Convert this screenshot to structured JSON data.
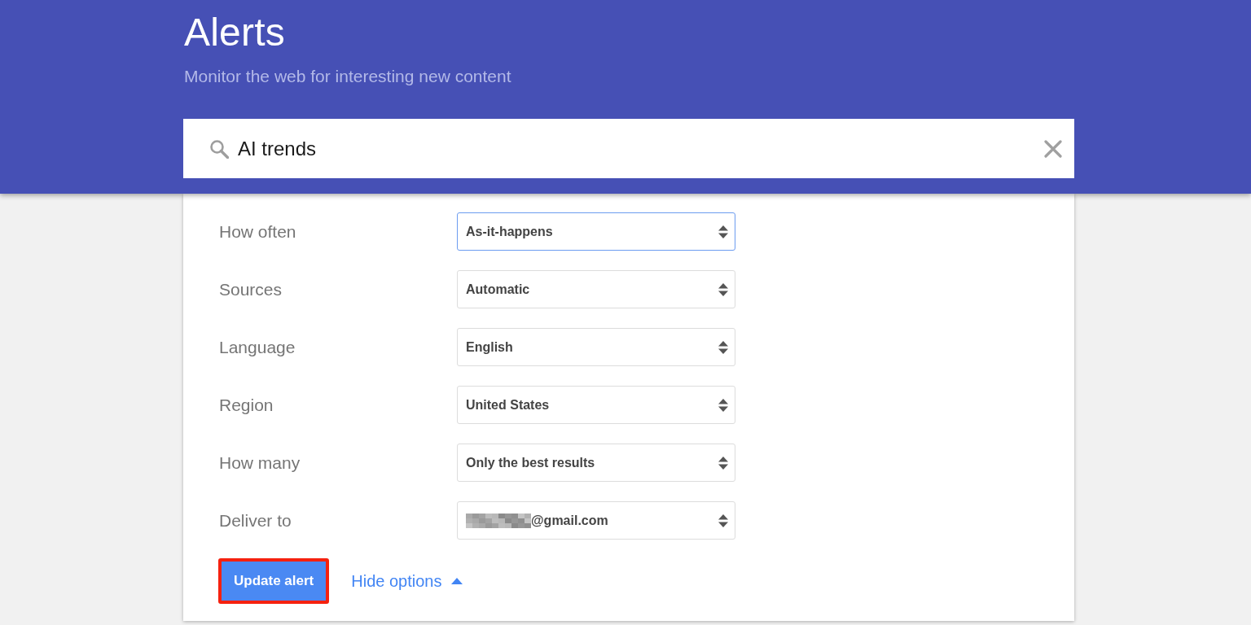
{
  "header": {
    "title": "Alerts",
    "subtitle": "Monitor the web for interesting new content"
  },
  "search": {
    "value": "AI trends"
  },
  "options": [
    {
      "label": "How often",
      "value": "As-it-happens",
      "focused": true,
      "redacted": false
    },
    {
      "label": "Sources",
      "value": "Automatic",
      "focused": false,
      "redacted": false
    },
    {
      "label": "Language",
      "value": "English",
      "focused": false,
      "redacted": false
    },
    {
      "label": "Region",
      "value": "United States",
      "focused": false,
      "redacted": false
    },
    {
      "label": "How many",
      "value": "Only the best results",
      "focused": false,
      "redacted": false
    },
    {
      "label": "Deliver to",
      "value": "@gmail.com",
      "focused": false,
      "redacted": true
    }
  ],
  "actions": {
    "primary": {
      "label": "Update alert",
      "highlighted": true
    },
    "toggle": {
      "label": "Hide options",
      "expanded": true
    }
  }
}
